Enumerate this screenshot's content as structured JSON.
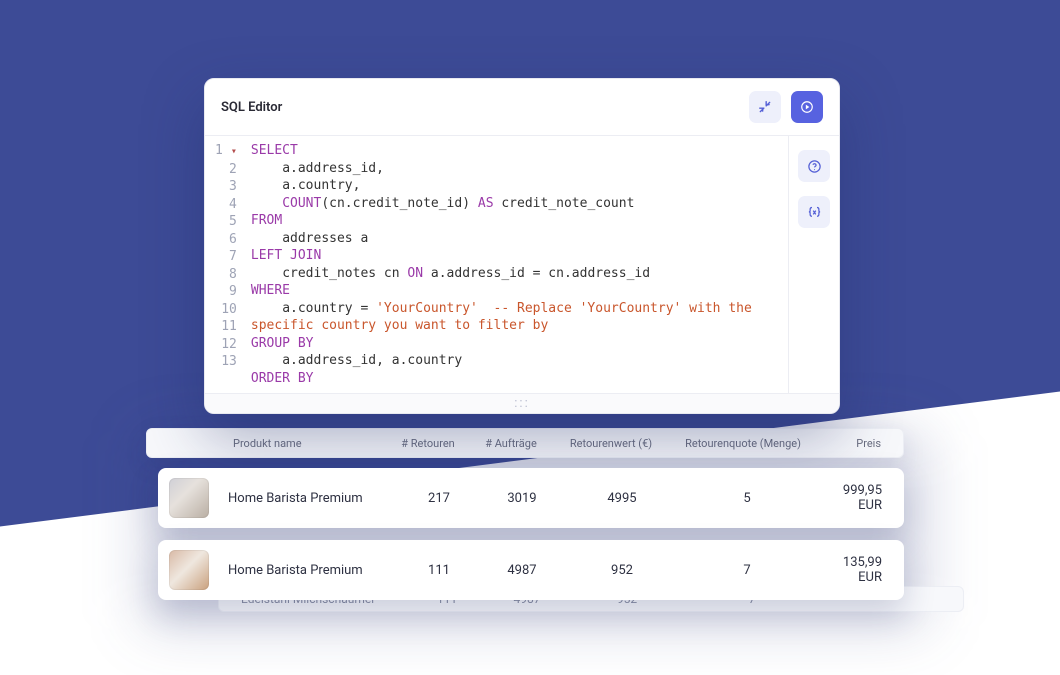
{
  "editor": {
    "title": "SQL Editor",
    "icons": {
      "collapse": "collapse-icon",
      "run": "play-icon",
      "help": "help-icon",
      "variables": "braces-icon"
    },
    "code_lines": [
      {
        "n": 1,
        "fold": true,
        "tokens": [
          {
            "t": "SELECT",
            "c": "kw"
          }
        ]
      },
      {
        "n": 2,
        "tokens": [
          {
            "t": "    a.address_id,",
            "c": "op"
          }
        ]
      },
      {
        "n": 3,
        "tokens": [
          {
            "t": "    a.country,",
            "c": "op"
          }
        ]
      },
      {
        "n": 4,
        "tokens": [
          {
            "t": "    ",
            "c": "op"
          },
          {
            "t": "COUNT",
            "c": "kw"
          },
          {
            "t": "(cn.credit_note_id) ",
            "c": "op"
          },
          {
            "t": "AS",
            "c": "kw"
          },
          {
            "t": " credit_note_count",
            "c": "op"
          }
        ]
      },
      {
        "n": 5,
        "tokens": [
          {
            "t": "FROM",
            "c": "kw"
          }
        ]
      },
      {
        "n": 6,
        "tokens": [
          {
            "t": "    addresses a",
            "c": "op"
          }
        ]
      },
      {
        "n": 7,
        "tokens": [
          {
            "t": "LEFT JOIN",
            "c": "kw"
          }
        ]
      },
      {
        "n": 8,
        "tokens": [
          {
            "t": "    credit_notes cn ",
            "c": "op"
          },
          {
            "t": "ON",
            "c": "kw"
          },
          {
            "t": " a.address_id = cn.address_id",
            "c": "op"
          }
        ]
      },
      {
        "n": 9,
        "tokens": [
          {
            "t": "WHERE",
            "c": "kw"
          }
        ]
      },
      {
        "n": 10,
        "tokens": [
          {
            "t": "    a.country = ",
            "c": "op"
          },
          {
            "t": "'YourCountry'",
            "c": "str"
          },
          {
            "t": "  -- Replace 'YourCountry' with the specific country you want to filter by",
            "c": "cm"
          }
        ]
      },
      {
        "n": 11,
        "tokens": [
          {
            "t": "GROUP BY",
            "c": "kw"
          }
        ]
      },
      {
        "n": 12,
        "tokens": [
          {
            "t": "    a.address_id, a.country",
            "c": "op"
          }
        ]
      },
      {
        "n": 13,
        "tokens": [
          {
            "t": "ORDER BY",
            "c": "kw"
          }
        ]
      }
    ],
    "drag_glyph": ":::"
  },
  "table": {
    "headers": {
      "name": "Produkt name",
      "returns": "# Retouren",
      "orders": "# Aufträge",
      "value": "Retourenwert (€)",
      "rate": "Retourenquote (Menge)",
      "price": "Preis"
    },
    "rows": [
      {
        "name": "Home Barista Premium",
        "returns": "217",
        "orders": "3019",
        "value": "4995",
        "rate": "5",
        "price": "999,95 EUR"
      },
      {
        "name": "Home Barista Premium",
        "returns": "111",
        "orders": "4987",
        "value": "952",
        "rate": "7",
        "price": "135,99 EUR"
      }
    ],
    "faint_row": {
      "name": "Edelstahl Milchschäumer",
      "returns": "111",
      "orders": "4987",
      "value": "952",
      "rate": "7"
    }
  }
}
